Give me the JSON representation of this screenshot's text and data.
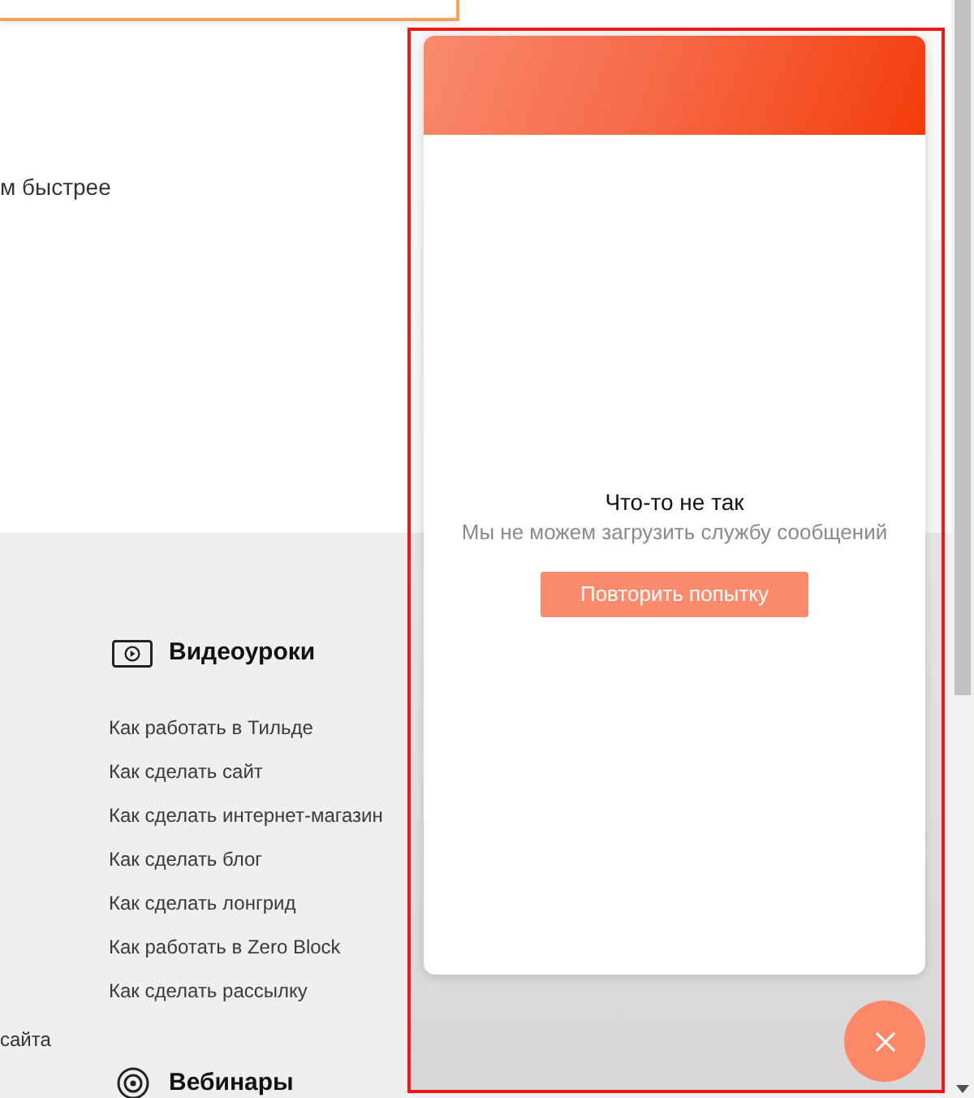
{
  "hero": {
    "text_fragment": "м быстрее"
  },
  "footer": {
    "left_column_fragment": "сайта",
    "sections": [
      {
        "kind": "video",
        "title": "Видеоуроки",
        "links": [
          "Как работать в Тильде",
          "Как сделать сайт",
          "Как сделать интернет-магазин",
          "Как сделать блог",
          "Как сделать лонгрид",
          "Как работать в Zero Block",
          "Как сделать рассылку"
        ]
      },
      {
        "kind": "webinar",
        "title": "Вебинары"
      }
    ]
  },
  "chat_widget": {
    "error_title": "Что-то не так",
    "error_message": "Мы не можем загрузить службу сообщений",
    "retry_button": "Повторить попытку"
  }
}
